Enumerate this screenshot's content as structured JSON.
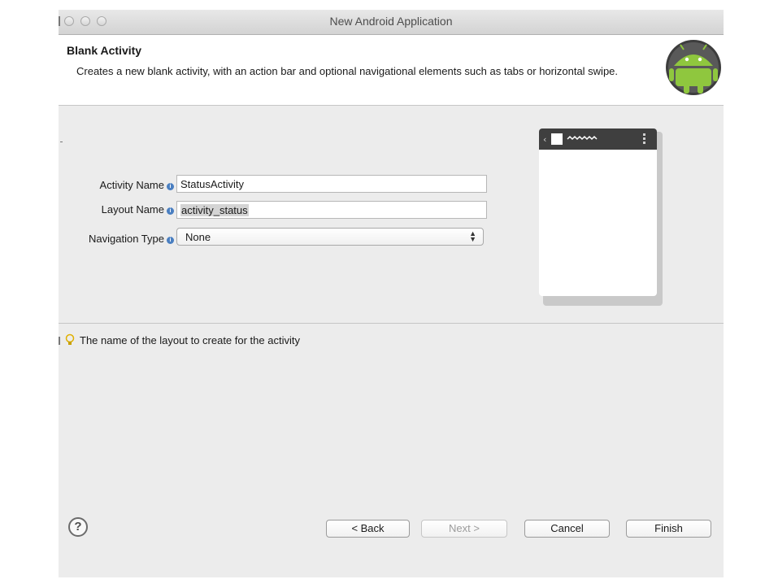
{
  "window": {
    "title": "New Android Application"
  },
  "header": {
    "title": "Blank Activity",
    "description": "Creates a new blank activity, with an action bar and optional navigational elements such as tabs or horizontal swipe."
  },
  "form": {
    "activity_name_label": "Activity Name",
    "activity_name_value": "StatusActivity",
    "layout_name_label": "Layout Name",
    "layout_name_value": "activity_status",
    "navigation_type_label": "Navigation Type",
    "navigation_type_value": "None"
  },
  "tip": {
    "text": "The name of the layout to create for the activity"
  },
  "buttons": {
    "back": "< Back",
    "next": "Next >",
    "cancel": "Cancel",
    "finish": "Finish"
  }
}
